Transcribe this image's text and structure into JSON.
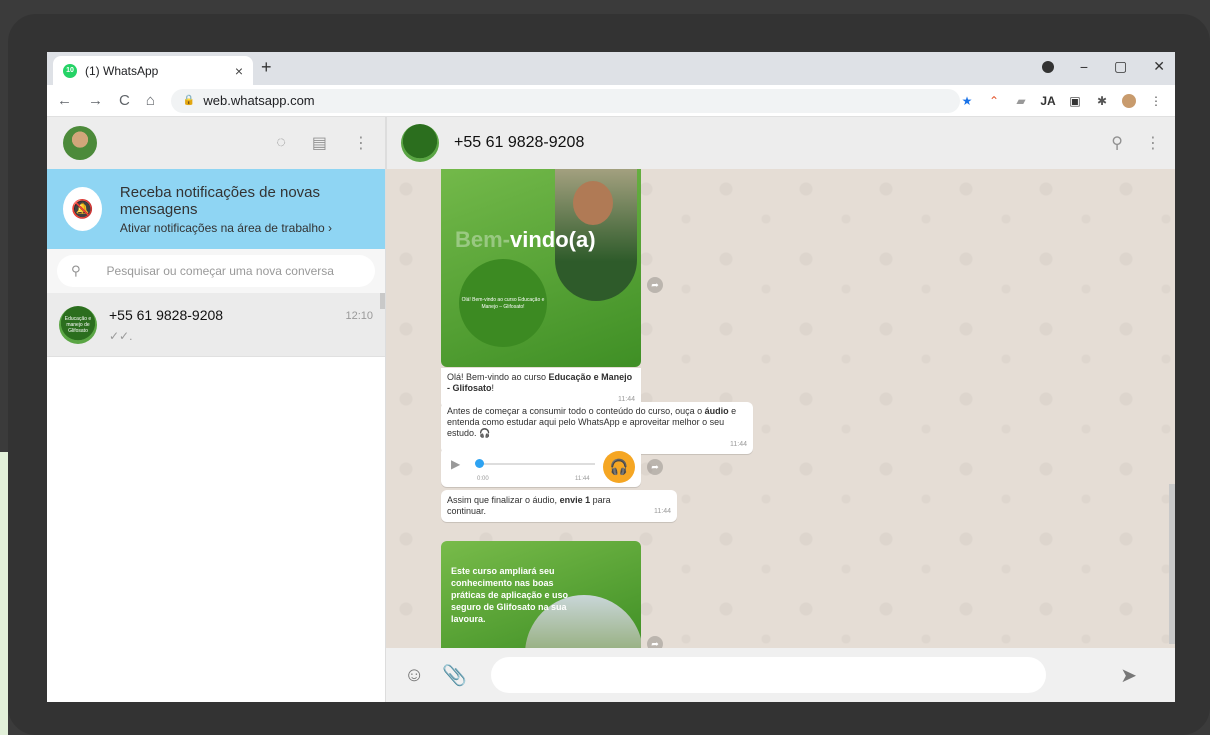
{
  "browser": {
    "tab_title": "(1) WhatsApp",
    "tab_badge": "10",
    "tab_close": "×",
    "new_tab": "+",
    "url": "web.whatsapp.com",
    "nav": {
      "back": "←",
      "forward": "→",
      "reload": "C",
      "home": "⌂"
    },
    "window": {
      "minimize": "−",
      "restore": "▢",
      "close": "✕"
    }
  },
  "left": {
    "notification": {
      "title": "Receba notificações de novas mensagens",
      "subtitle": "Ativar notificações na área de trabalho ›"
    },
    "search_placeholder": "Pesquisar ou começar uma nova conversa",
    "chats": [
      {
        "name": "+55 61 9828-9208",
        "preview": "✓✓.",
        "time": "12:10",
        "avatar_text": "Educação e manejo de Glifosato"
      }
    ]
  },
  "right": {
    "contact": "+55 61 9828-9208",
    "image1": {
      "headline_ghost": "Bem-",
      "headline": "vindo(a)",
      "circle_text": "Olá! Bem-vindo ao curso Educação e Manejo – Glifosato!"
    },
    "messages": [
      {
        "pre": "Olá! Bem-vindo ao curso ",
        "bold": "Educação e Manejo - Glifosato",
        "post": "!",
        "time": "11:44"
      },
      {
        "pre": "Antes de começar a consumir todo o conteúdo do curso, ouça o ",
        "bold": "áudio",
        "post": " e entenda como estudar aqui pelo WhatsApp e aproveitar melhor o seu estudo. 🎧",
        "time": "11:44"
      },
      {
        "pre": "Assim que finalizar o áudio, ",
        "bold": "envie 1",
        "post": " para continuar.",
        "time": "11:44"
      }
    ],
    "audio": {
      "current": "0:00",
      "time": "11:44"
    },
    "image2": {
      "text": "Este curso ampliará seu conhecimento nas boas práticas de aplicação e uso seguro de Glifosato na sua lavoura."
    }
  },
  "colors": {
    "notification_bg": "#8fd5f3",
    "accent": "#25d366",
    "audio_button": "#f5a623"
  }
}
